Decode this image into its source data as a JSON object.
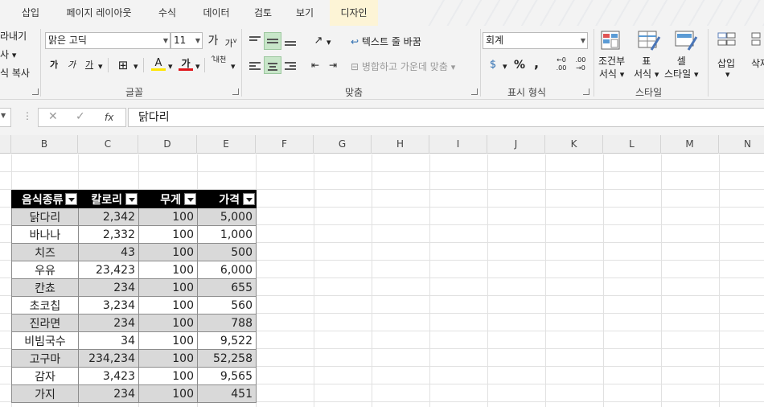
{
  "tabs": [
    "삽입",
    "페이지 레이아웃",
    "수식",
    "데이터",
    "검토",
    "보기",
    "디자인"
  ],
  "clipboard": {
    "cut_partial": "라내기",
    "copy_partial": "사",
    "format_painter_partial": "식 복사"
  },
  "font": {
    "name": "맑은 고딕",
    "size": "11",
    "grow_label": "가",
    "shrink_label": "가",
    "bold": "가",
    "italic": "가",
    "underline": "가",
    "fill_label": "A",
    "color_label": "가",
    "phonetic": "내천",
    "group_label": "글꼴"
  },
  "alignment": {
    "wrap_text": "텍스트 줄 바꿈",
    "merge_center": "병합하고 가운데 맞춤",
    "group_label": "맞춤"
  },
  "number": {
    "format": "회계",
    "percent": "%",
    "comma": ",",
    "inc_decimal": "←0 .00",
    "dec_decimal": ".00 →0",
    "group_label": "표시 형식"
  },
  "styles": {
    "conditional": [
      "조건부",
      "서식"
    ],
    "table": [
      "표",
      "서식"
    ],
    "cell": [
      "셀",
      "스타일"
    ],
    "group_label": "스타일"
  },
  "cells": {
    "insert": "삽입",
    "delete_partial": "삭제"
  },
  "formula_bar": {
    "fx": "fx",
    "value": "닭다리"
  },
  "columns": [
    "B",
    "C",
    "D",
    "E",
    "F",
    "G",
    "H",
    "I",
    "J",
    "K",
    "L",
    "M",
    "N"
  ],
  "table": {
    "headers": [
      "음식종류",
      "칼로리",
      "무게",
      "가격"
    ],
    "rows": [
      [
        "닭다리",
        "2,342",
        "100",
        "5,000"
      ],
      [
        "바나나",
        "2,332",
        "100",
        "1,000"
      ],
      [
        "치즈",
        "43",
        "100",
        "500"
      ],
      [
        "우유",
        "23,423",
        "100",
        "6,000"
      ],
      [
        "칸쵸",
        "234",
        "100",
        "655"
      ],
      [
        "초코칩",
        "3,234",
        "100",
        "560"
      ],
      [
        "진라면",
        "234",
        "100",
        "788"
      ],
      [
        "비빔국수",
        "34",
        "100",
        "9,522"
      ],
      [
        "고구마",
        "234,234",
        "100",
        "52,258"
      ],
      [
        "감자",
        "3,423",
        "100",
        "9,565"
      ],
      [
        "가지",
        "234",
        "100",
        "451"
      ]
    ]
  },
  "colors": {
    "selected_tab": "#fdf4d6",
    "header_row": "#000000",
    "band_row": "#d9d9d9",
    "ribbon": "#f3f3f3"
  }
}
